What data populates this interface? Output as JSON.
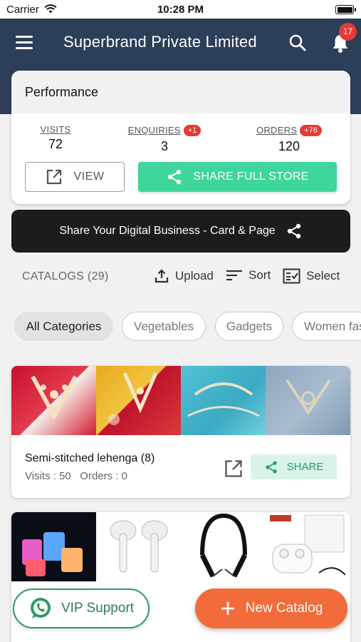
{
  "status_bar": {
    "carrier": "Carrier",
    "time": "10:28 PM"
  },
  "header": {
    "title": "Superbrand Private Limited",
    "notification_count": "17"
  },
  "performance": {
    "title": "Performance",
    "metrics": [
      {
        "label": "VISITS",
        "value": "72",
        "badge": ""
      },
      {
        "label": "ENQUIRIES",
        "value": "3",
        "badge": "+1"
      },
      {
        "label": "ORDERS",
        "value": "120",
        "badge": "+76"
      }
    ],
    "view_label": "VIEW",
    "share_store_label": "SHARE FULL STORE"
  },
  "digital_bar": {
    "label": "Share Your Digital Business - Card & Page"
  },
  "catalogs": {
    "count_label": "CATALOGS (29)",
    "upload_label": "Upload",
    "sort_label": "Sort",
    "select_label": "Select"
  },
  "categories": [
    "All Categories",
    "Vegetables",
    "Gadgets",
    "Women fas"
  ],
  "catalog_items": [
    {
      "name": "Semi-stitched lehenga (8)",
      "visits": "Visits : 50",
      "orders": "Orders : 0",
      "share_label": "SHARE"
    }
  ],
  "fab": {
    "vip_label": "VIP Support",
    "new_catalog_label": "New Catalog"
  },
  "colors": {
    "header_bg": "#2c3e58",
    "accent_green": "#3ed69a",
    "badge_red": "#e53a35",
    "fab_orange": "#f26b3a",
    "whatsapp_green": "#2e9a63"
  },
  "icons": [
    "wifi-icon",
    "battery-icon",
    "menu-icon",
    "search-icon",
    "bell-icon",
    "external-link-icon",
    "share-icon",
    "upload-icon",
    "sort-icon",
    "select-icon",
    "whatsapp-icon",
    "plus-icon"
  ]
}
